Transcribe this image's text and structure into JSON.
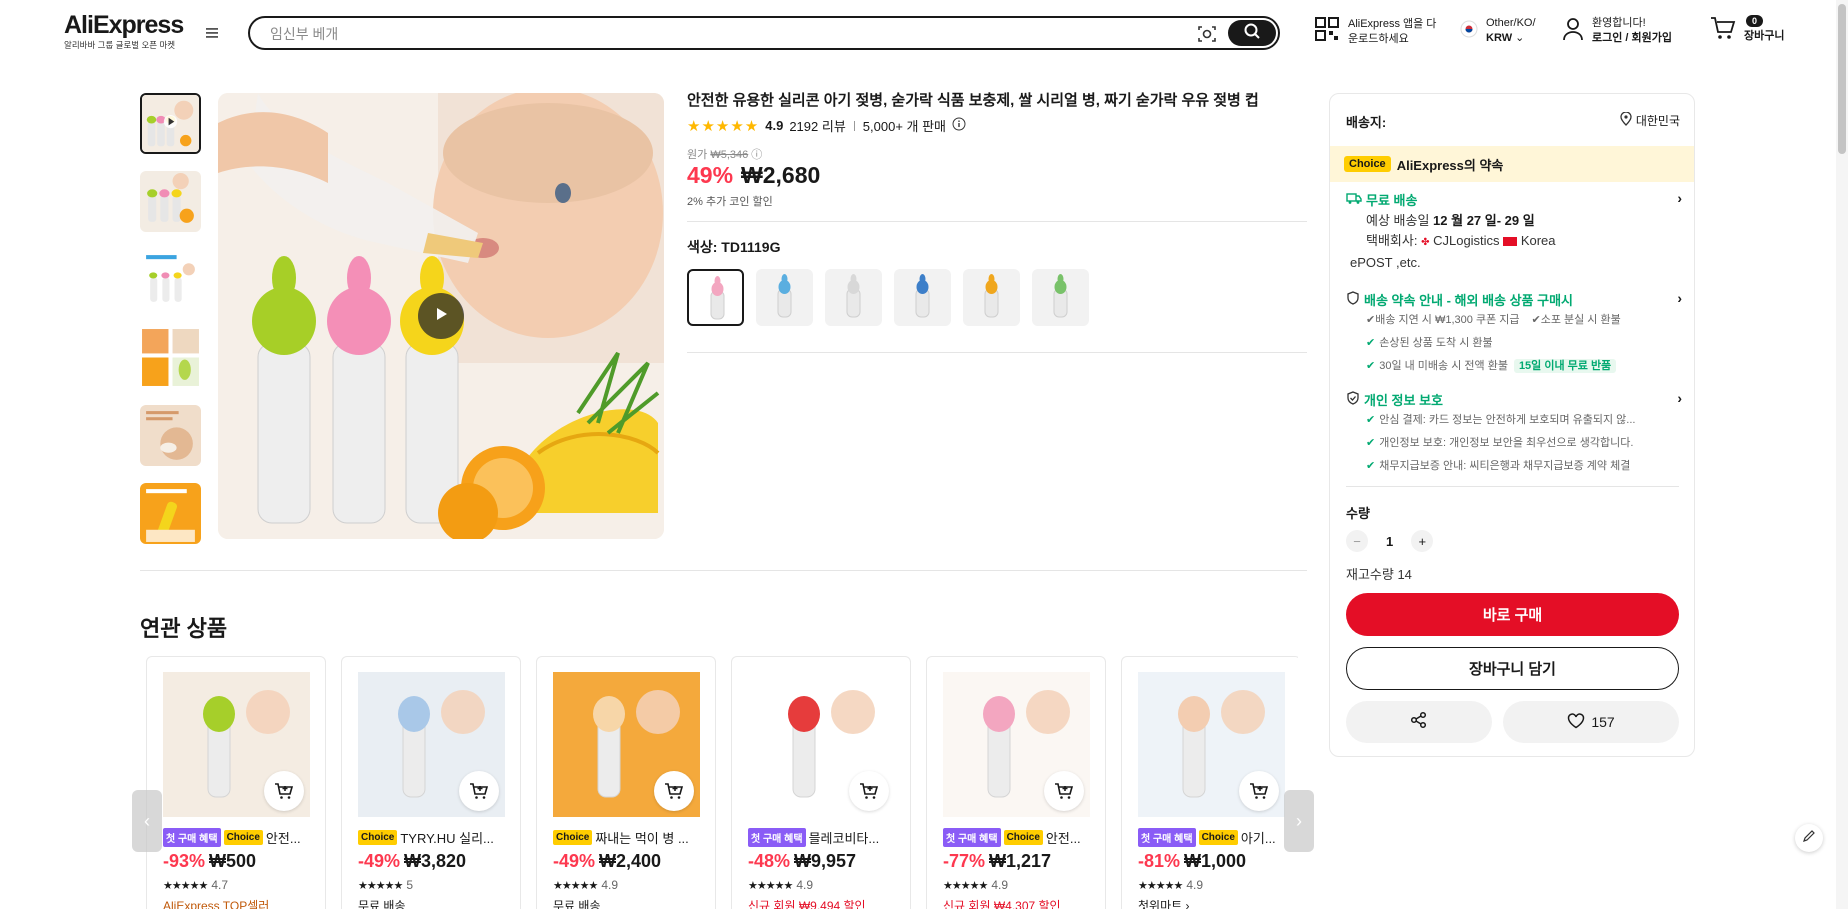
{
  "header": {
    "logo": "AliExpress",
    "logo_sub": "알리바바 그룹 글로벌 오픈 마켓",
    "search_placeholder": "임신부 베개",
    "app_line1": "AliExpress 앱을 다",
    "app_line2": "운로드하세요",
    "lang_line1": "Other/KO/",
    "lang_line2": "KRW",
    "account_line1": "환영합니다!",
    "account_line2": "로그인 / 회원가입",
    "cart_count": "0",
    "cart_label": "장바구니"
  },
  "product": {
    "title": "안전한 유용한 실리콘 아기 젖병, 숟가락 식품 보충제, 쌀 시리얼 병, 짜기 숟가락 우유 젖병 컵",
    "stars": "★★★★★",
    "rating": "4.9",
    "reviews": "2192 리뷰",
    "sold": "5,000+ 개 판매",
    "orig_label": "원가",
    "orig_price": "₩5,346",
    "discount": "49%",
    "price": "₩2,680",
    "coin_discount": "2% 추가 코인 할인",
    "color_label": "색상: TD1119G",
    "swatch_colors": [
      "#f3a6c0",
      "#5aaee0",
      "#d8d8d8",
      "#3d7fc9",
      "#f0a71e",
      "#79c26a"
    ]
  },
  "panel": {
    "ship_to_label": "배송지:",
    "ship_to_value": "대한민국",
    "choice_badge": "Choice",
    "promise": "AliExpress의 약속",
    "free_ship": "무료 배송",
    "est_label": "예상 배송일",
    "est_dates": "12 월 27 일- 29 일",
    "carrier_label": "택배회사:",
    "carrier_1": "CJLogistics",
    "carrier_2": "Korea",
    "carrier_3": "ePOST ,etc.",
    "guarantee_head": "배송 약속 안내 - 해외 배송 상품 구매시",
    "guarantee_1": "배송 지연 시 ₩1,300 쿠폰 지급",
    "guarantee_2": "소포 분실 시 환불",
    "guarantee_3": "손상된 상품 도착 시 환불",
    "guarantee_4": "30일 내 미배송 시 전액 환불",
    "return_tag": "15일 이내 무료 반품",
    "privacy_head": "개인 정보 보호",
    "privacy_1": "안심 결제: 카드 정보는 안전하게 보호되며 유출되지 않...",
    "privacy_2": "개인정보 보호: 개인정보 보안을 최우선으로 생각합니다.",
    "privacy_3": "채무지급보증 안내: 씨티은행과 채무지급보증 계약 체결",
    "qty_label": "수량",
    "qty_value": "1",
    "stock": "재고수량 14",
    "buy_now": "바로 구매",
    "add_cart": "장바구니 담기",
    "wish_count": "157"
  },
  "related": {
    "title": "연관 상품",
    "items": [
      {
        "tag1": "첫 구매 혜택",
        "tag2": "Choice",
        "name": "안전...",
        "pct": "-93%",
        "price": "₩500",
        "rating": "4.7",
        "extra": "AliExpress TOP셀러",
        "extra_color": "#c0590a"
      },
      {
        "tag1": "",
        "tag2": "Choice",
        "name": "TYRY.HU 실리...",
        "pct": "-49%",
        "price": "₩3,820",
        "rating": "5",
        "extra": "무료 배송",
        "extra_color": "#191919"
      },
      {
        "tag1": "",
        "tag2": "Choice",
        "name": "짜내는 먹이 병 ...",
        "pct": "-49%",
        "price": "₩2,400",
        "rating": "4.9",
        "extra": "무료 배송",
        "extra_color": "#191919"
      },
      {
        "tag1": "첫 구매 혜택",
        "tag2": "",
        "name": "믈레코비타...",
        "pct": "-48%",
        "price": "₩9,957",
        "rating": "4.9",
        "extra": "신규 회원 ₩9,494 할인",
        "extra_color": "#e40e26"
      },
      {
        "tag1": "첫 구매 혜택",
        "tag2": "Choice",
        "name": "안전...",
        "pct": "-77%",
        "price": "₩1,217",
        "rating": "4.9",
        "extra": "신규 회원 ₩4,307 할인",
        "extra_color": "#e40e26"
      },
      {
        "tag1": "첫 구매 혜택",
        "tag2": "Choice",
        "name": "아기...",
        "pct": "-81%",
        "price": "₩1,000",
        "rating": "4.9",
        "extra": "첫위마트 ›",
        "extra_color": "#191919"
      }
    ]
  }
}
